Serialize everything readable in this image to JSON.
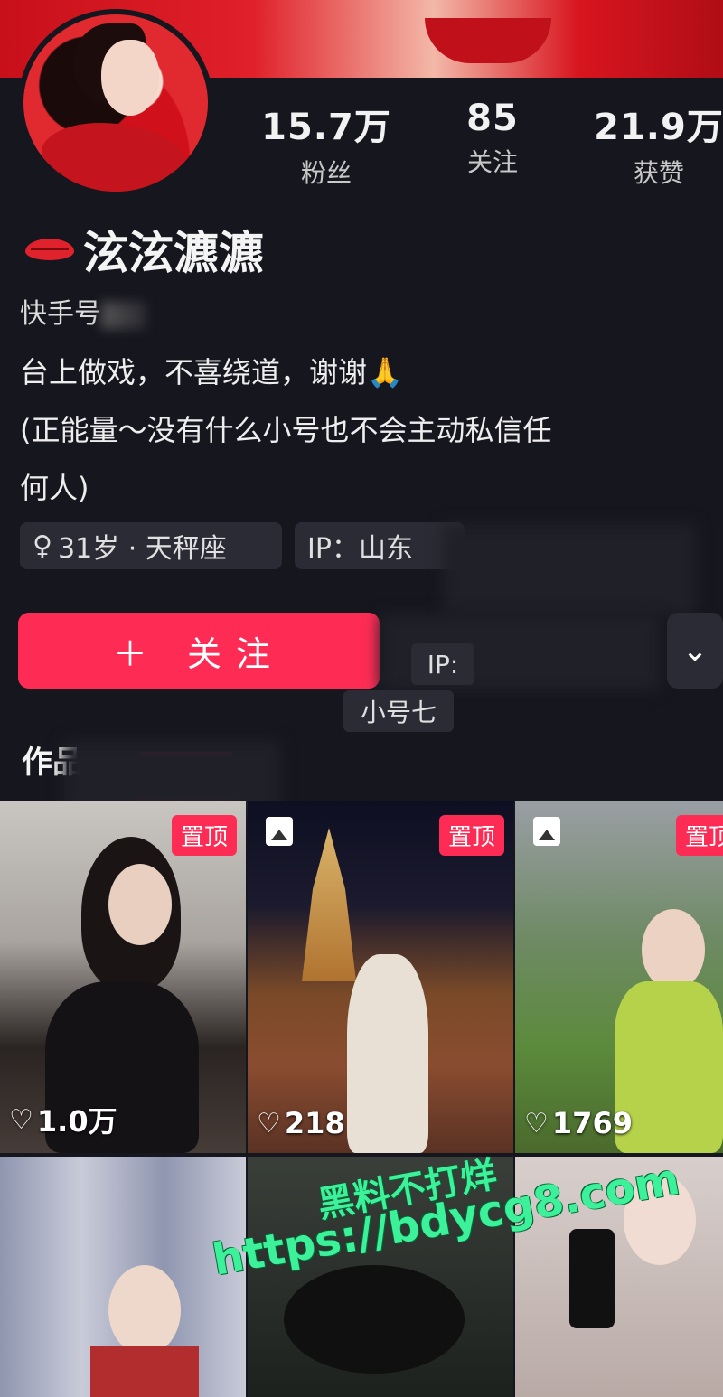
{
  "profile": {
    "name": "泫泫瀌瀌",
    "kuaishou_label": "快手号",
    "bio_line1": "台上做戏，不喜绕道，谢谢🙏",
    "bio_line2": "(正能量～没有什么小号也不会主动私信任",
    "bio_line3": "何人)",
    "tag_age": "31岁 · 天秤座",
    "tag_ip": "IP：山东",
    "gender_icon": "female-icon"
  },
  "stats": [
    {
      "value": "15.7万",
      "label": "粉丝"
    },
    {
      "value": "85",
      "label": "关注"
    },
    {
      "value": "21.9万",
      "label": "获赞"
    }
  ],
  "actions": {
    "follow_label": "＋ 关注",
    "chevron": "⌄",
    "ip_overlay": "IP:",
    "xiaohao_overlay": "小号七"
  },
  "tabs": {
    "works_label": "作品"
  },
  "grid": [
    {
      "likes": "1.0万",
      "pinned": true,
      "pin_label": "置顶",
      "image": false
    },
    {
      "likes": "218",
      "pinned": true,
      "pin_label": "置顶",
      "image": true
    },
    {
      "likes": "1769",
      "pinned": true,
      "pin_label": "置顶",
      "image": true
    },
    {
      "likes": "",
      "pinned": false,
      "image": false
    },
    {
      "likes": "",
      "pinned": false,
      "image": false
    },
    {
      "likes": "",
      "pinned": false,
      "image": false
    }
  ],
  "watermark": {
    "line1": "黑料不打烊",
    "line2": "https://bdycg8.com"
  },
  "colors": {
    "accent": "#fe2c55",
    "background": "#16161e",
    "watermark": "#3df09a"
  }
}
